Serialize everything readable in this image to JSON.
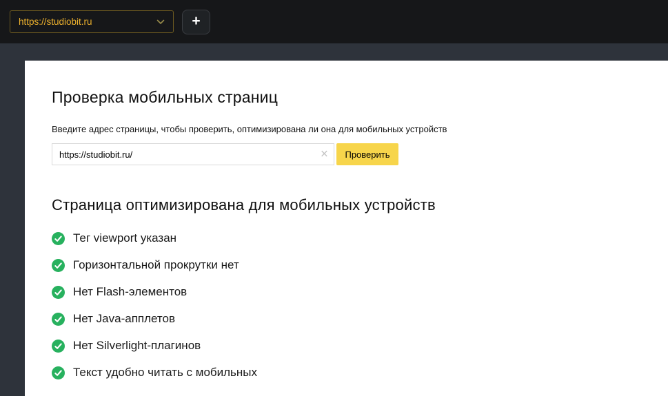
{
  "header": {
    "site_selector": {
      "value": "https://studiobit.ru"
    },
    "add_button_label": "+"
  },
  "main": {
    "title": "Проверка мобильных страниц",
    "subtitle": "Введите адрес страницы, чтобы проверить, оптимизирована ли она для мобильных устройств",
    "url_input": {
      "value": "https://studiobit.ru/",
      "clear_label": "×"
    },
    "check_button_label": "Проверить",
    "result": {
      "heading": "Страница оптимизирована для мобильных устройств",
      "checks": [
        {
          "label": "Тег viewport указан",
          "status": "pass"
        },
        {
          "label": "Горизонтальной прокрутки нет",
          "status": "pass"
        },
        {
          "label": "Нет Flash-элементов",
          "status": "pass"
        },
        {
          "label": "Нет Java-апплетов",
          "status": "pass"
        },
        {
          "label": "Нет Silverlight-плагинов",
          "status": "pass"
        },
        {
          "label": "Текст удобно читать с мобильных",
          "status": "pass"
        }
      ]
    }
  },
  "colors": {
    "header_bg": "#161719",
    "frame_bg": "#2e333b",
    "accent_yellow": "#f7d54b",
    "selector_yellow": "#eeb22d",
    "success_green": "#27b15e"
  }
}
